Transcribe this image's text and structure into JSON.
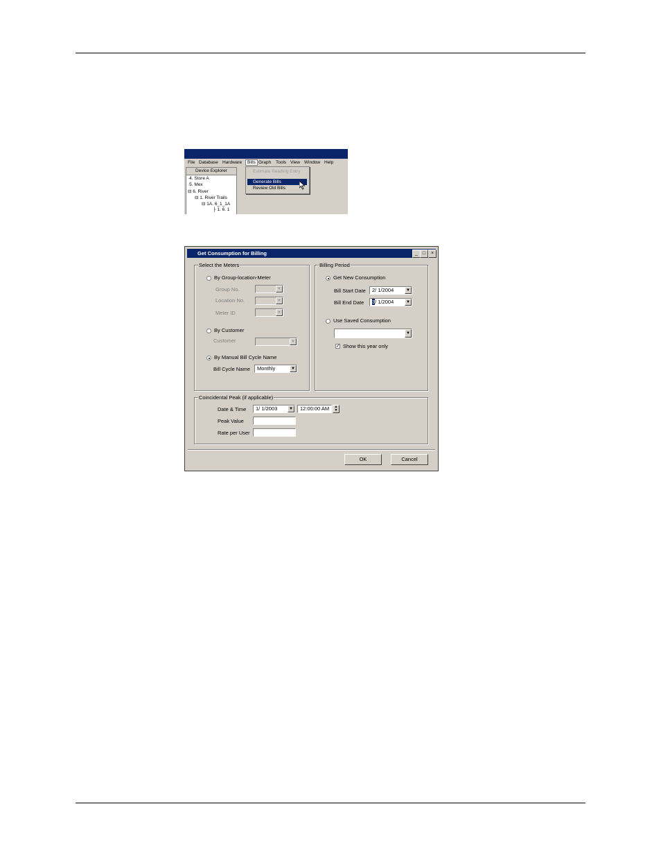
{
  "menu_screenshot": {
    "menu": [
      "File",
      "Database",
      "Hardware",
      "Bills",
      "Graph",
      "Tools",
      "View",
      "Window",
      "Help"
    ],
    "explorer_title": "Device Explorer",
    "tree": [
      "4. Store A",
      "5. Mex",
      "6. River",
      "1. River Trails",
      "1A. 6_1_1A",
      "1. 6. 1"
    ],
    "bills_menu": {
      "disabled_item": "Estimate Reading Entry",
      "highlighted_item": "Generate Bills",
      "item": "Review Old Bills"
    }
  },
  "dialog": {
    "title": "Get Consumption for Billing",
    "window_buttons": [
      "_",
      "□",
      "×"
    ],
    "select_meters": {
      "legend": "Select the Meters",
      "by_group": "By Group-location-Meter",
      "group_no": "Group No.",
      "location_no": "Location No.",
      "meter_id": "Meter ID",
      "by_customer": "By Customer",
      "customer": "Customer",
      "by_manual": "By Manual Bill Cycle Name",
      "bill_cycle_label": "Bill Cycle Name",
      "bill_cycle_value": "Monthly",
      "selected": "By Manual Bill Cycle Name"
    },
    "billing_period": {
      "legend": "Billing Period",
      "get_new": "Get New Consumption",
      "start_label": "Bill Start Date",
      "start_value": "2/ 1/2004",
      "end_label": "Bill End Date",
      "end_caret": "3",
      "end_value": "/ 1/2004",
      "use_saved": "Use Saved Consumption",
      "show_year": "Show this year only",
      "show_year_checked": true,
      "selected": "Get New Consumption"
    },
    "coincidental": {
      "legend": "Coincidental Peak (if applicable)",
      "date_time_label": "Date & Time",
      "date_value": "1/ 1/2003",
      "time_value": "12:00:00 AM",
      "peak_value_label": "Peak Value",
      "rate_label": "Rate per User"
    },
    "ok": "OK",
    "cancel": "Cancel"
  }
}
